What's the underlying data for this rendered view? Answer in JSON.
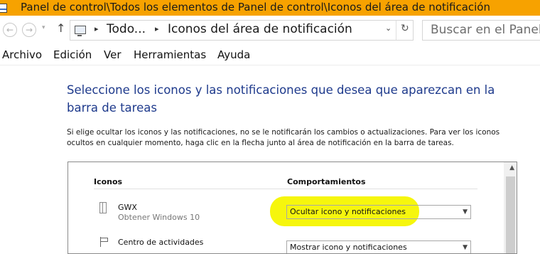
{
  "window": {
    "title": "Panel de control\\Todos los elementos de Panel de control\\Iconos del área de notificación"
  },
  "nav": {
    "back_icon": "←",
    "forward_icon": "→",
    "recent_icon": "▾",
    "up_icon": "↑"
  },
  "address": {
    "sep": "▸",
    "crumb1": "Todo...",
    "crumb2": "Iconos del área de notificación",
    "dropdown_icon": "⌄",
    "refresh_icon": "↻"
  },
  "search": {
    "placeholder": "Buscar en el Panel de control"
  },
  "menu": {
    "items": [
      "Archivo",
      "Edición",
      "Ver",
      "Herramientas",
      "Ayuda"
    ]
  },
  "main": {
    "heading": "Seleccione los iconos y las notificaciones que desea que aparezcan en la barra de tareas",
    "description": "Si elige ocultar los iconos y las notificaciones, no se le notificarán los cambios o actualizaciones. Para ver los iconos ocultos en cualquier momento, haga clic en la flecha junto al área de notificación en la barra de tareas."
  },
  "table": {
    "col_icons": "Iconos",
    "col_behaviors": "Comportamientos",
    "rows": [
      {
        "name": "GWX",
        "sub": "Obtener Windows 10",
        "behavior": "Ocultar icono y notificaciones",
        "icon": "gwx-icon"
      },
      {
        "name": "Centro de actividades",
        "sub": "",
        "behavior": "Mostrar icono y notificaciones",
        "icon": "flag-icon"
      }
    ]
  },
  "colors": {
    "titlebar": "#f7a200",
    "heading": "#1e3a8c",
    "highlight": "#f6f600"
  }
}
